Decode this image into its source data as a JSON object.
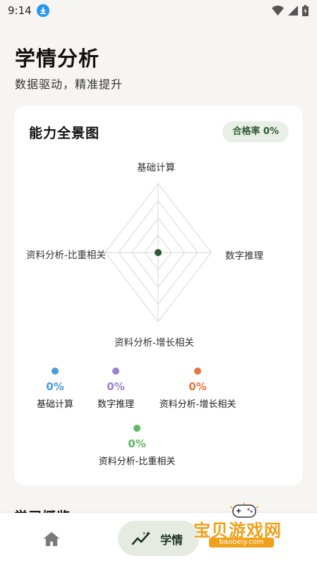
{
  "status_bar": {
    "time": "9:14"
  },
  "header": {
    "title": "学情分析",
    "subtitle": "数据驱动，精准提升"
  },
  "ability_card": {
    "title": "能力全景图",
    "pass_rate": "合格率 0%",
    "axes": [
      "基础计算",
      "数字推理",
      "资料分析-增长相关",
      "资料分析-比重相关"
    ],
    "center_color": "#2e5a34",
    "legend": [
      {
        "name": "基础计算",
        "value": "0%",
        "color": "#4a9be0"
      },
      {
        "name": "数字推理",
        "value": "0%",
        "color": "#9b7fd4"
      },
      {
        "name": "资料分析-增长相关",
        "value": "0%",
        "color": "#e8743e"
      },
      {
        "name": "资料分析-比重相关",
        "value": "0%",
        "color": "#5fb865"
      }
    ]
  },
  "next_section_title": "学习概览",
  "bottom_nav": {
    "study_label": "学情",
    "active_color": "#e5ebe1"
  },
  "watermark": {
    "text": "宝贝游戏网",
    "url": "baobeiy.com"
  }
}
